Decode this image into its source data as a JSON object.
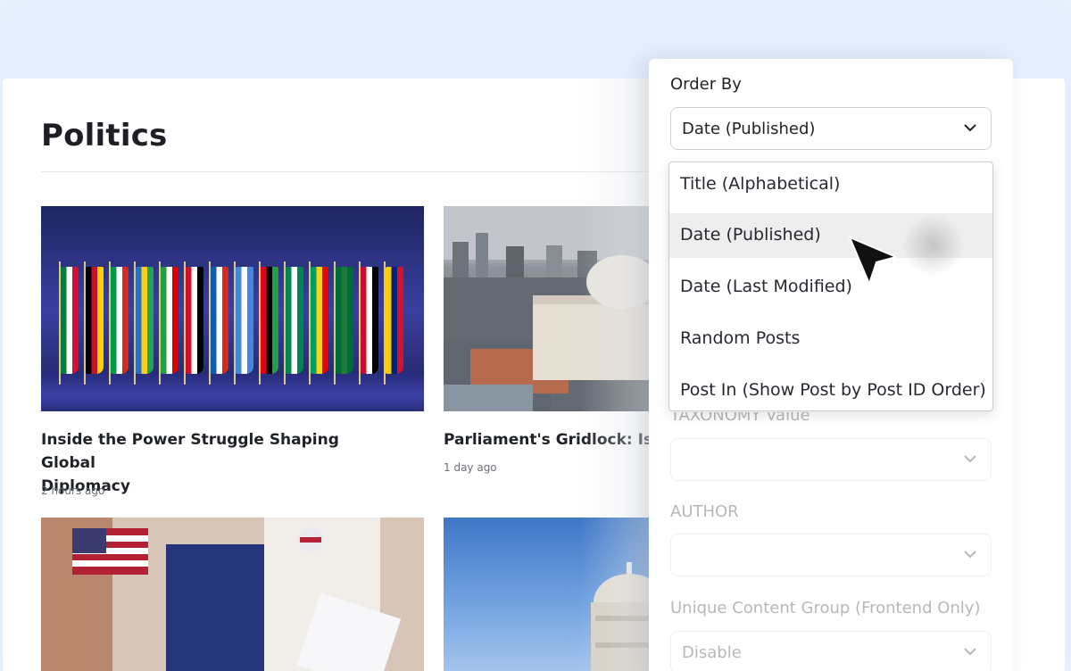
{
  "page": {
    "title": "Politics"
  },
  "posts": [
    {
      "title": "Inside the Power Struggle Shaping Global Diplomacy",
      "title_line1": "Inside the Power Struggle Shaping Global",
      "title_line2": "Diplomacy",
      "time": "2 hours ago"
    },
    {
      "title": "Parliament's Gridlock: Is Po",
      "time": "1 day ago"
    },
    {
      "title": ""
    },
    {
      "title": ""
    }
  ],
  "panel": {
    "order_by": {
      "label": "Order By",
      "selected": "Date (Published)",
      "options": [
        "Title (Alphabetical)",
        "Date (Published)",
        "Date (Last Modified)",
        "Random Posts",
        "Post In (Show Post by Post ID Order)"
      ]
    },
    "taxonomy_value": {
      "label": "TAXONOMY Value",
      "value": ""
    },
    "author": {
      "label": "AUTHOR",
      "value": ""
    },
    "unique_group": {
      "label": "Unique Content Group (Frontend Only)",
      "value": "Disable"
    }
  },
  "colors": {
    "background": "#e4eefc",
    "highlight": "#eeeeee",
    "text": "#1f2226"
  },
  "icons": [
    "chevron-down-icon",
    "mouse-pointer-icon"
  ]
}
